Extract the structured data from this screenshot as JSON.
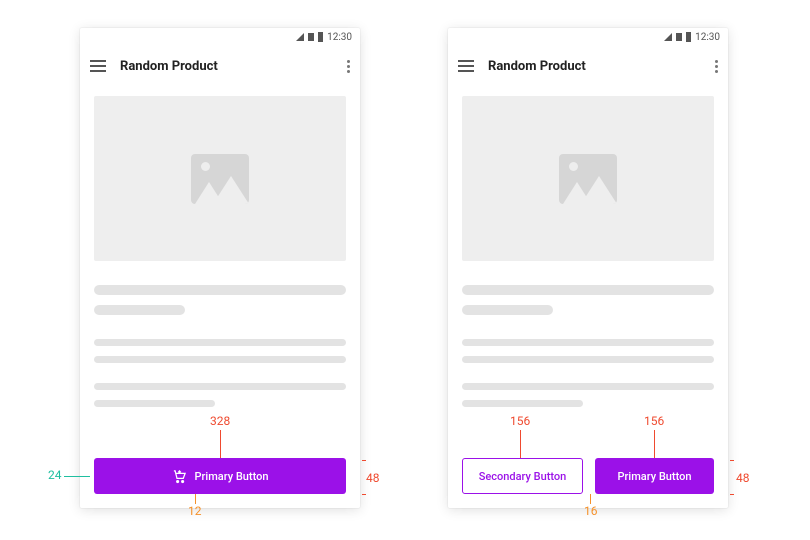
{
  "status": {
    "time": "12:30"
  },
  "appbar": {
    "title": "Random Product"
  },
  "left": {
    "primary_label": "Primary Button"
  },
  "right": {
    "primary_label": "Primary Button",
    "secondary_label": "Secondary Button"
  },
  "annotations": {
    "left_width": "328",
    "left_height": "48",
    "left_icon": "24",
    "left_iconpad": "12",
    "right_btn_w_a": "156",
    "right_btn_w_b": "156",
    "right_gap": "16",
    "right_height": "48"
  }
}
